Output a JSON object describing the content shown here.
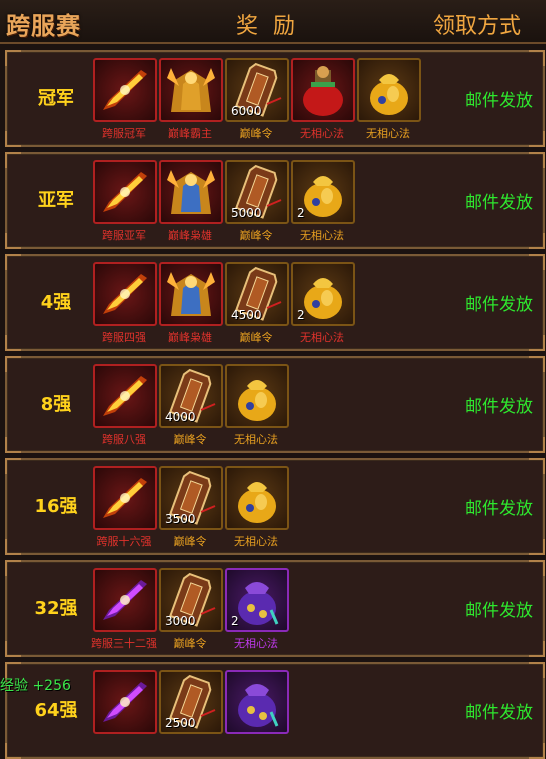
{
  "header": {
    "logo": "跨服赛",
    "col_reward": "奖 励",
    "col_method": "领取方式"
  },
  "rows": [
    {
      "rank": "冠军",
      "method": "邮件发放",
      "items": [
        {
          "name": "跨服冠军",
          "icon": "title-banner-icon",
          "style": "red",
          "nameColor": "c-red",
          "count": ""
        },
        {
          "name": "巅峰霸主",
          "icon": "armor-golden-icon",
          "style": "red",
          "nameColor": "c-red",
          "count": ""
        },
        {
          "name": "巅峰令",
          "icon": "token-plaque-icon",
          "style": "gold",
          "nameColor": "c-orange",
          "count": "6000"
        },
        {
          "name": "无相心法",
          "icon": "treasure-bag-red-icon",
          "style": "red",
          "nameColor": "c-red",
          "count": ""
        },
        {
          "name": "无相心法",
          "icon": "treasure-bag-icon",
          "style": "gold",
          "nameColor": "c-orange",
          "count": ""
        }
      ]
    },
    {
      "rank": "亚军",
      "method": "邮件发放",
      "items": [
        {
          "name": "跨服亚军",
          "icon": "title-banner-icon",
          "style": "red",
          "nameColor": "c-red",
          "count": ""
        },
        {
          "name": "巅峰枭雄",
          "icon": "armor-blue-icon",
          "style": "red",
          "nameColor": "c-red",
          "count": ""
        },
        {
          "name": "巅峰令",
          "icon": "token-plaque-icon",
          "style": "gold",
          "nameColor": "c-orange",
          "count": "5000"
        },
        {
          "name": "无相心法",
          "icon": "treasure-bag-icon",
          "style": "gold",
          "nameColor": "c-orange",
          "count": "2"
        }
      ]
    },
    {
      "rank": "4强",
      "method": "邮件发放",
      "items": [
        {
          "name": "跨服四强",
          "icon": "title-banner-icon",
          "style": "red",
          "nameColor": "c-red",
          "count": ""
        },
        {
          "name": "巅峰枭雄",
          "icon": "armor-blue-icon",
          "style": "red",
          "nameColor": "c-red",
          "count": ""
        },
        {
          "name": "巅峰令",
          "icon": "token-plaque-icon",
          "style": "gold",
          "nameColor": "c-orange",
          "count": "4500"
        },
        {
          "name": "无相心法",
          "icon": "treasure-bag-icon",
          "style": "gold",
          "nameColor": "c-red",
          "count": "2"
        }
      ]
    },
    {
      "rank": "8强",
      "method": "邮件发放",
      "items": [
        {
          "name": "跨服八强",
          "icon": "title-banner-icon",
          "style": "red",
          "nameColor": "c-red",
          "count": ""
        },
        {
          "name": "巅峰令",
          "icon": "token-plaque-icon",
          "style": "gold",
          "nameColor": "c-orange",
          "count": "4000"
        },
        {
          "name": "无相心法",
          "icon": "treasure-bag-icon",
          "style": "gold",
          "nameColor": "c-orange",
          "count": ""
        }
      ]
    },
    {
      "rank": "16强",
      "method": "邮件发放",
      "items": [
        {
          "name": "跨服十六强",
          "icon": "title-banner-icon",
          "style": "red",
          "nameColor": "c-red",
          "count": ""
        },
        {
          "name": "巅峰令",
          "icon": "token-plaque-icon",
          "style": "gold",
          "nameColor": "c-orange",
          "count": "3500"
        },
        {
          "name": "无相心法",
          "icon": "treasure-bag-icon",
          "style": "gold",
          "nameColor": "c-orange",
          "count": ""
        }
      ]
    },
    {
      "rank": "32强",
      "method": "邮件发放",
      "items": [
        {
          "name": "跨服三十二强",
          "icon": "title-banner-purple-icon",
          "style": "red",
          "nameColor": "c-red",
          "count": ""
        },
        {
          "name": "巅峰令",
          "icon": "token-plaque-icon",
          "style": "gold",
          "nameColor": "c-orange",
          "count": "3000"
        },
        {
          "name": "无相心法",
          "icon": "treasure-bag-purple-icon",
          "style": "purple",
          "nameColor": "c-purple",
          "count": "2"
        }
      ]
    },
    {
      "rank": "64强",
      "method": "邮件发放",
      "items": [
        {
          "name": "",
          "icon": "title-banner-purple-icon",
          "style": "red",
          "nameColor": "c-red",
          "count": ""
        },
        {
          "name": "",
          "icon": "token-plaque-icon",
          "style": "gold",
          "nameColor": "c-orange",
          "count": "2500"
        },
        {
          "name": "",
          "icon": "treasure-bag-purple-icon",
          "style": "purple",
          "nameColor": "c-purple",
          "count": ""
        }
      ]
    }
  ],
  "floating_text": "经验 +256",
  "colors": {
    "rank": "#ffd21c",
    "method": "#2ee82e",
    "header": "#f0a640"
  }
}
